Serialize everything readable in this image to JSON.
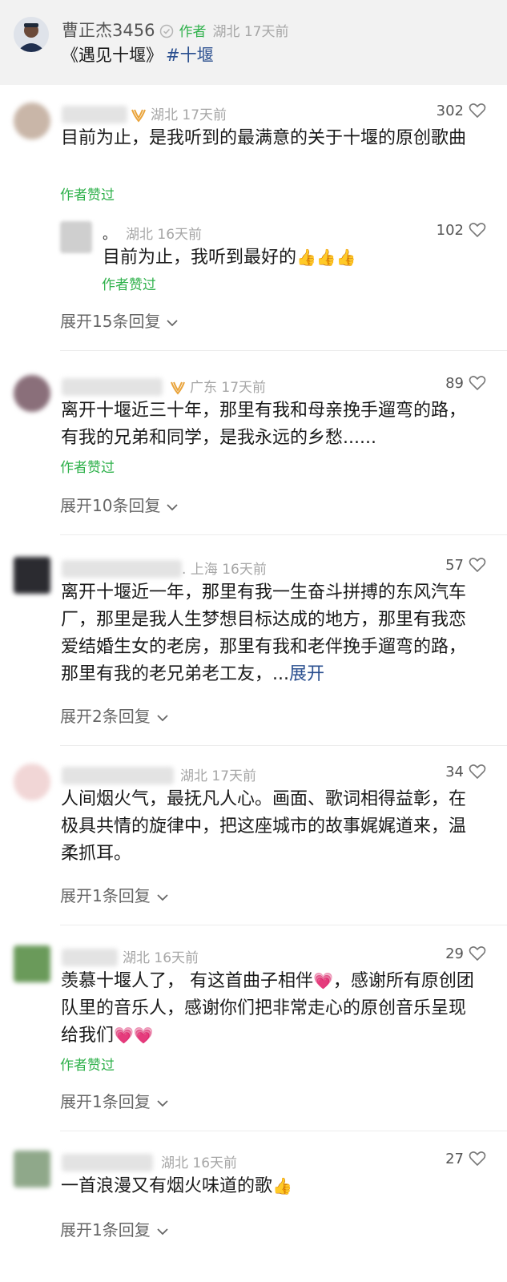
{
  "post": {
    "author": "曹正杰3456",
    "author_tag": "作者",
    "meta": "湖北 17天前",
    "title": "《遇见十堰》",
    "hashtag": "#十堰"
  },
  "comments": [
    {
      "meta": "湖北 17天前",
      "likes": "302",
      "text": "目前为止，是我听到的最满意的关于十堰的原创歌曲",
      "liked_by": "作者赞过",
      "reply": {
        "name": "。",
        "meta": "湖北 16天前",
        "likes": "102",
        "text": "目前为止，我听到最好的",
        "emoji": "👍👍👍",
        "liked_by": "作者赞过"
      },
      "expand": "展开15条回复"
    },
    {
      "meta": "广东 17天前",
      "likes": "89",
      "text": "离开十堰近三十年，那里有我和母亲挽手遛弯的路，有我的兄弟和同学，是我永远的乡愁......",
      "liked_by": "作者赞过",
      "expand": "展开10条回复"
    },
    {
      "meta": ". 上海 16天前",
      "likes": "57",
      "text": "离开十堰近一年，那里有我一生奋斗拼搏的东风汽车厂，那里是我人生梦想目标达成的地方，那里有我恋爱结婚生女的老房，那里有我和老伴挽手遛弯的路，那里有我的老兄弟老工友，...",
      "more": "展开",
      "expand": "展开2条回复"
    },
    {
      "meta": "湖北 17天前",
      "likes": "34",
      "text": "人间烟火气，最抚凡人心。画面、歌词相得益彰，在极具共情的旋律中，把这座城市的故事娓娓道来，温柔抓耳。",
      "expand": "展开1条回复"
    },
    {
      "meta": "湖北 16天前",
      "likes": "29",
      "text_a": "羡慕十堰人了， 有这首曲子相伴",
      "emoji_a": "💗",
      "text_b": "，感谢所有原创团队里的音乐人，感谢你们把非常走心的原创音乐呈现给我们",
      "emoji_b": "💗💗",
      "liked_by": "作者赞过",
      "expand": "展开1条回复"
    },
    {
      "meta": "湖北 16天前",
      "likes": "27",
      "text": "一首浪漫又有烟火味道的歌",
      "emoji": "👍",
      "expand": "展开1条回复"
    }
  ],
  "icons": {
    "verified": "verified-check-icon",
    "vip": "vip-wings-icon",
    "like": "heart-outline-icon",
    "chevron": "chevron-down-icon"
  },
  "colors": {
    "accent_green": "#2fb14b",
    "link_blue": "#2a4f8f",
    "meta_gray": "#a6a6a6",
    "header_bg": "#f2f2f2"
  }
}
